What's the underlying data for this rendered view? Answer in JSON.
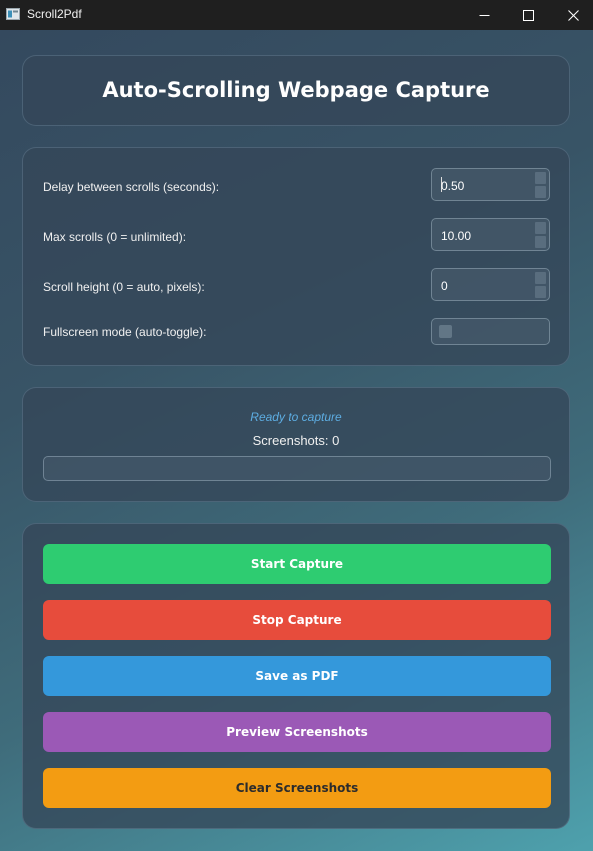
{
  "window": {
    "title": "Scroll2Pdf"
  },
  "header": {
    "title": "Auto-Scrolling Webpage Capture"
  },
  "settings": {
    "delay_label": "Delay between scrolls (seconds):",
    "delay_value": "0.50",
    "max_scrolls_label": "Max scrolls (0 = unlimited):",
    "max_scrolls_value": "10.00",
    "scroll_height_label": "Scroll height (0 = auto, pixels):",
    "scroll_height_value": "0",
    "fullscreen_label": "Fullscreen mode (auto-toggle):",
    "fullscreen_checked": false
  },
  "status": {
    "message": "Ready to capture",
    "screenshots": "Screenshots: 0",
    "progress_fraction": 0,
    "message_color": "#5dade2"
  },
  "actions": [
    {
      "label": "Start Capture",
      "color": "#2ecc71"
    },
    {
      "label": "Stop Capture",
      "color": "#e74c3c"
    },
    {
      "label": "Save as PDF",
      "color": "#3498db"
    },
    {
      "label": "Preview Screenshots",
      "color": "#9b59b6"
    },
    {
      "label": "Clear Screenshots",
      "color": "#f39c12"
    }
  ],
  "icons": {
    "app": "app-window-icon",
    "minimize": "minimize-icon",
    "maximize": "maximize-icon",
    "close": "close-icon"
  }
}
